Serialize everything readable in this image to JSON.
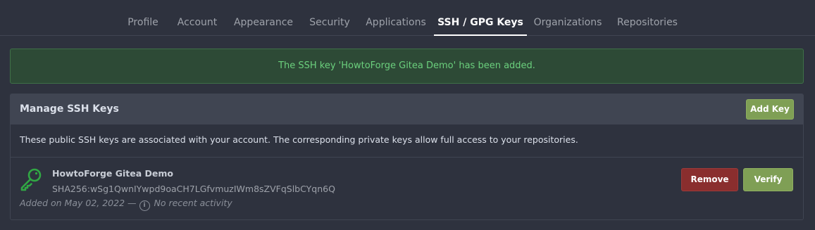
{
  "tabs": [
    {
      "label": "Profile",
      "active": false
    },
    {
      "label": "Account",
      "active": false
    },
    {
      "label": "Appearance",
      "active": false
    },
    {
      "label": "Security",
      "active": false
    },
    {
      "label": "Applications",
      "active": false
    },
    {
      "label": "SSH / GPG Keys",
      "active": true
    },
    {
      "label": "Organizations",
      "active": false
    },
    {
      "label": "Repositories",
      "active": false
    }
  ],
  "flash": {
    "message": "The SSH key 'HowtoForge Gitea Demo' has been added."
  },
  "panel": {
    "title": "Manage SSH Keys",
    "add_key_label": "Add Key",
    "description": "These public SSH keys are associated with your account. The corresponding private keys allow full access to your repositories."
  },
  "key": {
    "name": "HowtoForge Gitea Demo",
    "fingerprint": "SHA256:wSg1QwnIYwpd9oaCH7LGfvmuzIWm8sZVFqSlbCYqn6Q",
    "added": "Added on May 02, 2022 —",
    "activity": "No recent activity",
    "icon": "key-icon",
    "info_icon": "info-icon",
    "info_icon_glyph": "i",
    "remove_label": "Remove",
    "verify_label": "Verify",
    "icon_color": "#31a744"
  },
  "colors": {
    "accent_green": "#7f9f55",
    "danger_red": "#8a2e2e",
    "success_text": "#6bd07d",
    "background": "#2e323e"
  }
}
